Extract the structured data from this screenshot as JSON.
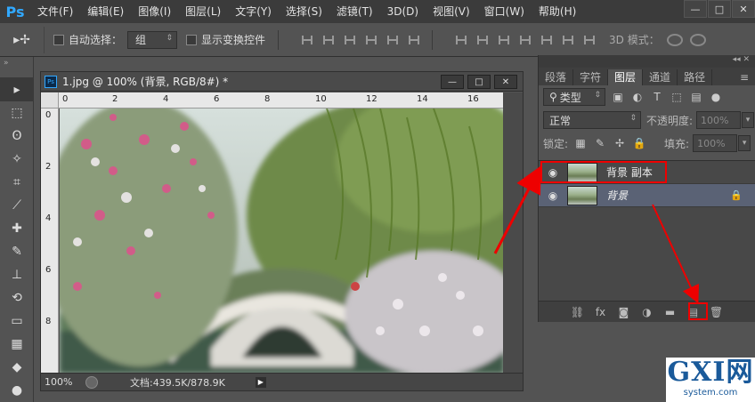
{
  "app": {
    "logo": "Ps",
    "brand_color": "#31a8ff"
  },
  "menu": [
    "文件(F)",
    "编辑(E)",
    "图像(I)",
    "图层(L)",
    "文字(Y)",
    "选择(S)",
    "滤镜(T)",
    "3D(D)",
    "视图(V)",
    "窗口(W)",
    "帮助(H)"
  ],
  "window_controls": {
    "minimize": "—",
    "maximize": "□",
    "close": "✕"
  },
  "options": {
    "auto_select_label": "自动选择：",
    "auto_select_value": "组",
    "show_transform_label": "显示变换控件",
    "mode_3d_label": "3D 模式："
  },
  "document": {
    "title": "1.jpg @ 100% (背景, RGB/8#) *",
    "ruler_h": [
      "0",
      "2",
      "4",
      "6",
      "8",
      "10",
      "12",
      "14",
      "16"
    ],
    "ruler_v": [
      "0",
      "2",
      "4",
      "6",
      "8"
    ],
    "zoom": "100%",
    "doc_info": "文档:439.5K/878.9K"
  },
  "panel": {
    "tabs": [
      "段落",
      "字符",
      "图层",
      "通道",
      "路径"
    ],
    "active_tab": "图层",
    "filter_label": "类型",
    "blend_mode": "正常",
    "opacity_label": "不透明度:",
    "opacity_value": "100%",
    "lock_label": "锁定:",
    "fill_label": "填充:",
    "fill_value": "100%",
    "layers": [
      {
        "name": "背景 副本",
        "selected": false,
        "italic": false,
        "locked": false
      },
      {
        "name": "背景",
        "selected": true,
        "italic": true,
        "locked": true
      }
    ]
  },
  "watermark": {
    "top": "GXI网",
    "bottom": "system.com"
  },
  "colors": {
    "highlight": "#e00000",
    "panel_bg": "#535353",
    "menu_bg": "#3b3b3b"
  }
}
